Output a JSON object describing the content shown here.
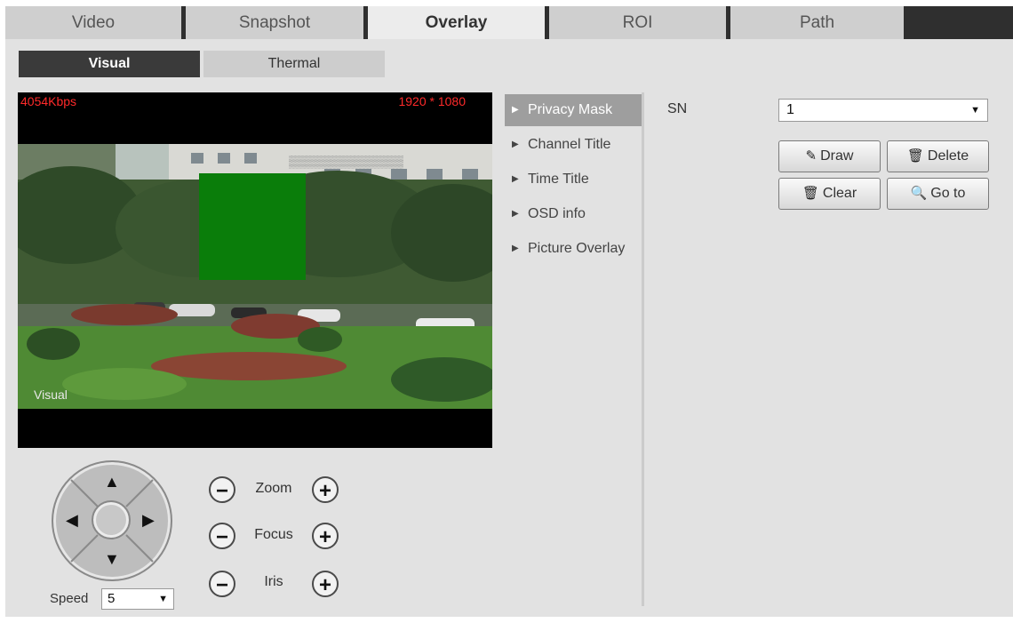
{
  "tabs": [
    "Video",
    "Snapshot",
    "Overlay",
    "ROI",
    "Path"
  ],
  "active_tab": "Overlay",
  "sub_tabs": [
    "Visual",
    "Thermal"
  ],
  "active_sub_tab": "Visual",
  "video": {
    "bitrate": "4054Kbps",
    "resolution": "1920 * 1080",
    "channel_label": "Visual",
    "privacy_mask_color": "#0a7d0a"
  },
  "ptz": {
    "zoom_label": "Zoom",
    "focus_label": "Focus",
    "iris_label": "Iris",
    "speed_label": "Speed",
    "speed_value": "5",
    "minus": "−",
    "plus": "+",
    "arrow_up": "▲",
    "arrow_down": "▼",
    "arrow_left": "◀",
    "arrow_right": "▶"
  },
  "menu": [
    "Privacy Mask",
    "Channel Title",
    "Time Title",
    "OSD info",
    "Picture Overlay"
  ],
  "active_menu": "Privacy Mask",
  "panel": {
    "sn_label": "SN",
    "sn_value": "1",
    "buttons": {
      "draw": "Draw",
      "delete": "Delete",
      "clear": "Clear",
      "goto": "Go to"
    },
    "icons": {
      "draw": "edit-icon",
      "delete": "trash-icon",
      "clear": "trash-icon",
      "goto": "search-icon"
    }
  },
  "colors": {
    "tab_active_bg": "#ececec",
    "sub_tab_active_bg": "#3a3a3a",
    "menu_active_bg": "#9e9e9e",
    "osd_text": "#ff2a2a"
  }
}
